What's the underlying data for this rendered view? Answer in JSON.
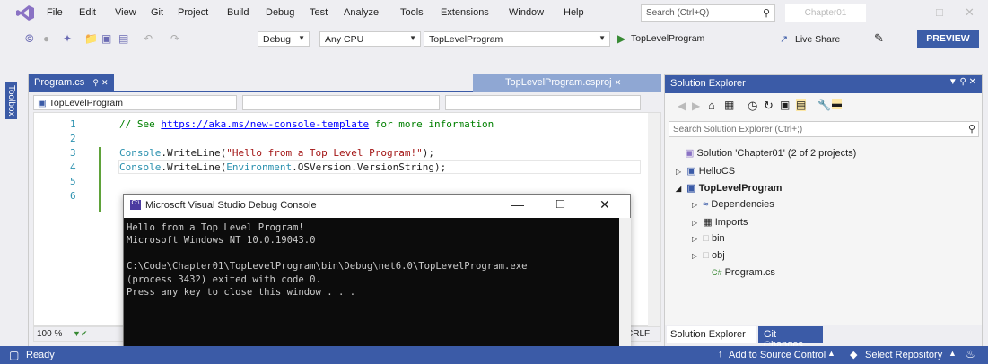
{
  "menubar": {
    "items": [
      "File",
      "Edit",
      "View",
      "Git",
      "Project",
      "Build",
      "Debug",
      "Test",
      "Analyze",
      "Tools",
      "Extensions",
      "Window",
      "Help"
    ],
    "search_placeholder": "Search (Ctrl+Q)",
    "project_name": "Chapter01"
  },
  "toolbar": {
    "config": "Debug",
    "platform": "Any CPU",
    "startup": "TopLevelProgram",
    "run_label": "TopLevelProgram",
    "live_share": "Live Share",
    "preview": "PREVIEW"
  },
  "toolbox": {
    "label": "Toolbox"
  },
  "editor": {
    "tab_active": "Program.cs",
    "tab_other": "TopLevelProgram.csproj",
    "nav_scope": "TopLevelProgram",
    "zoom": "100 %",
    "line_ending": "CRLF",
    "lines": [
      {
        "num": "1"
      },
      {
        "num": "2"
      },
      {
        "num": "3"
      },
      {
        "num": "4"
      },
      {
        "num": "5"
      },
      {
        "num": "6"
      }
    ],
    "code1_comment": "// See ",
    "code1_link": "https://aka.ms/new-console-template",
    "code1_rest": " for more information",
    "code3_a": "Console",
    "code3_b": ".WriteLine(",
    "code3_c": "\"Hello from a Top Level Program!\"",
    "code3_d": ");",
    "code4_a": "Console",
    "code4_b": ".WriteLine(",
    "code4_c": "Environment",
    "code4_d": ".OSVersion.VersionString);"
  },
  "console": {
    "title": "Microsoft Visual Studio Debug Console",
    "output": "Hello from a Top Level Program!\nMicrosoft Windows NT 10.0.19043.0\n\nC:\\Code\\Chapter01\\TopLevelProgram\\bin\\Debug\\net6.0\\TopLevelProgram.exe\n(process 3432) exited with code 0.\nPress any key to close this window . . ."
  },
  "solution_explorer": {
    "title": "Solution Explorer",
    "search_placeholder": "Search Solution Explorer (Ctrl+;)",
    "solution": "Solution 'Chapter01' (2 of 2 projects)",
    "project1": "HelloCS",
    "project2": "TopLevelProgram",
    "children": [
      "Dependencies",
      "Imports",
      "bin",
      "obj",
      "Program.cs"
    ],
    "tab1": "Solution Explorer",
    "tab2": "Git Changes"
  },
  "statusbar": {
    "ready": "Ready",
    "source_control": "Add to Source Control",
    "repository": "Select Repository"
  }
}
